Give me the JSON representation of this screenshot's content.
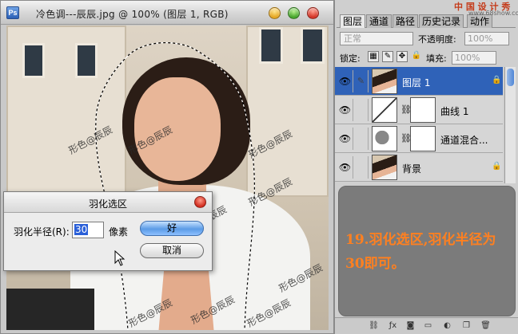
{
  "document_window": {
    "title": "冷色调---辰辰.jpg @ 100% (图层 1, RGB)",
    "app_icon": "Ps"
  },
  "canvas": {
    "watermarks": [
      "形色@辰辰",
      "形色@辰辰",
      "形色@辰辰",
      "形色@辰辰",
      "形色@辰辰",
      "形色@辰辰",
      "形色@辰辰",
      "形色@辰辰",
      "形色@辰辰"
    ]
  },
  "feather_dialog": {
    "title": "羽化选区",
    "radius_label": "羽化半径(R):",
    "radius_value": "30",
    "unit": "像素",
    "ok_label": "好",
    "cancel_label": "取消"
  },
  "layers_panel": {
    "site_mark": "中 国 设 计 秀",
    "site_mark_sub": "www.68show.com",
    "tabs": [
      {
        "label": "图层",
        "active": true
      },
      {
        "label": "通道",
        "active": false
      },
      {
        "label": "路径",
        "active": false
      },
      {
        "label": "历史记录",
        "active": false
      },
      {
        "label": "动作",
        "active": false
      }
    ],
    "blend_mode": "正常",
    "opacity_label": "不透明度:",
    "opacity_value": "100%",
    "lock_label": "锁定:",
    "fill_label": "填充:",
    "fill_value": "100%",
    "layers": [
      {
        "name": "图层 1",
        "active": true,
        "locked": true
      },
      {
        "name": "曲线 1",
        "active": false,
        "locked": false
      },
      {
        "name": "通道混合...",
        "active": false,
        "locked": false
      },
      {
        "name": "背景",
        "active": false,
        "locked": true
      }
    ],
    "note": "19.羽化选区,羽化半径为30即可。"
  },
  "colors": {
    "selection_blue": "#2f62b8",
    "note_orange": "#ff8020",
    "note_bg": "#7b7b7b"
  }
}
